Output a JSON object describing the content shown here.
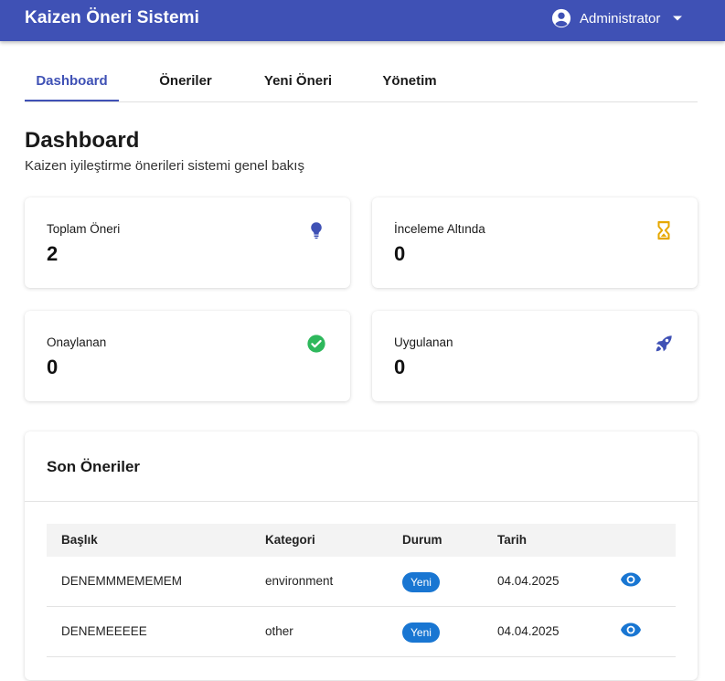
{
  "app": {
    "title": "Kaizen Öneri Sistemi"
  },
  "user": {
    "name": "Administrator",
    "avatar_icon": "account-circle-icon",
    "menu_icon": "caret-down-icon"
  },
  "tabs": [
    {
      "label": "Dashboard",
      "active": true
    },
    {
      "label": "Öneriler",
      "active": false
    },
    {
      "label": "Yeni Öneri",
      "active": false
    },
    {
      "label": "Yönetim",
      "active": false
    }
  ],
  "page": {
    "title": "Dashboard",
    "subtitle": "Kaizen iyileştirme önerileri sistemi genel bakış"
  },
  "stats": [
    {
      "label": "Toplam Öneri",
      "value": "2",
      "icon": "lightbulb-icon",
      "color": "#3f51b5"
    },
    {
      "label": "İnceleme Altında",
      "value": "0",
      "icon": "hourglass-icon",
      "color": "#e6a800"
    },
    {
      "label": "Onaylanan",
      "value": "0",
      "icon": "check-circle-icon",
      "color": "#2eb85c"
    },
    {
      "label": "Uygulanan",
      "value": "0",
      "icon": "rocket-icon",
      "color": "#3f51b5"
    }
  ],
  "recent": {
    "title": "Son Öneriler",
    "columns": [
      "Başlık",
      "Kategori",
      "Durum",
      "Tarih"
    ],
    "rows": [
      {
        "title": "DENEMMMEMEMEM",
        "category": "environment",
        "status": "Yeni",
        "date": "04.04.2025",
        "action_icon": "eye-icon"
      },
      {
        "title": "DENEMEEEEE",
        "category": "other",
        "status": "Yeni",
        "date": "04.04.2025",
        "action_icon": "eye-icon"
      }
    ]
  },
  "colors": {
    "primary": "#3f51b5",
    "badge": "#1976d2",
    "view_icon": "#1976d2",
    "pending": "#e6a800",
    "approved": "#2eb85c"
  }
}
